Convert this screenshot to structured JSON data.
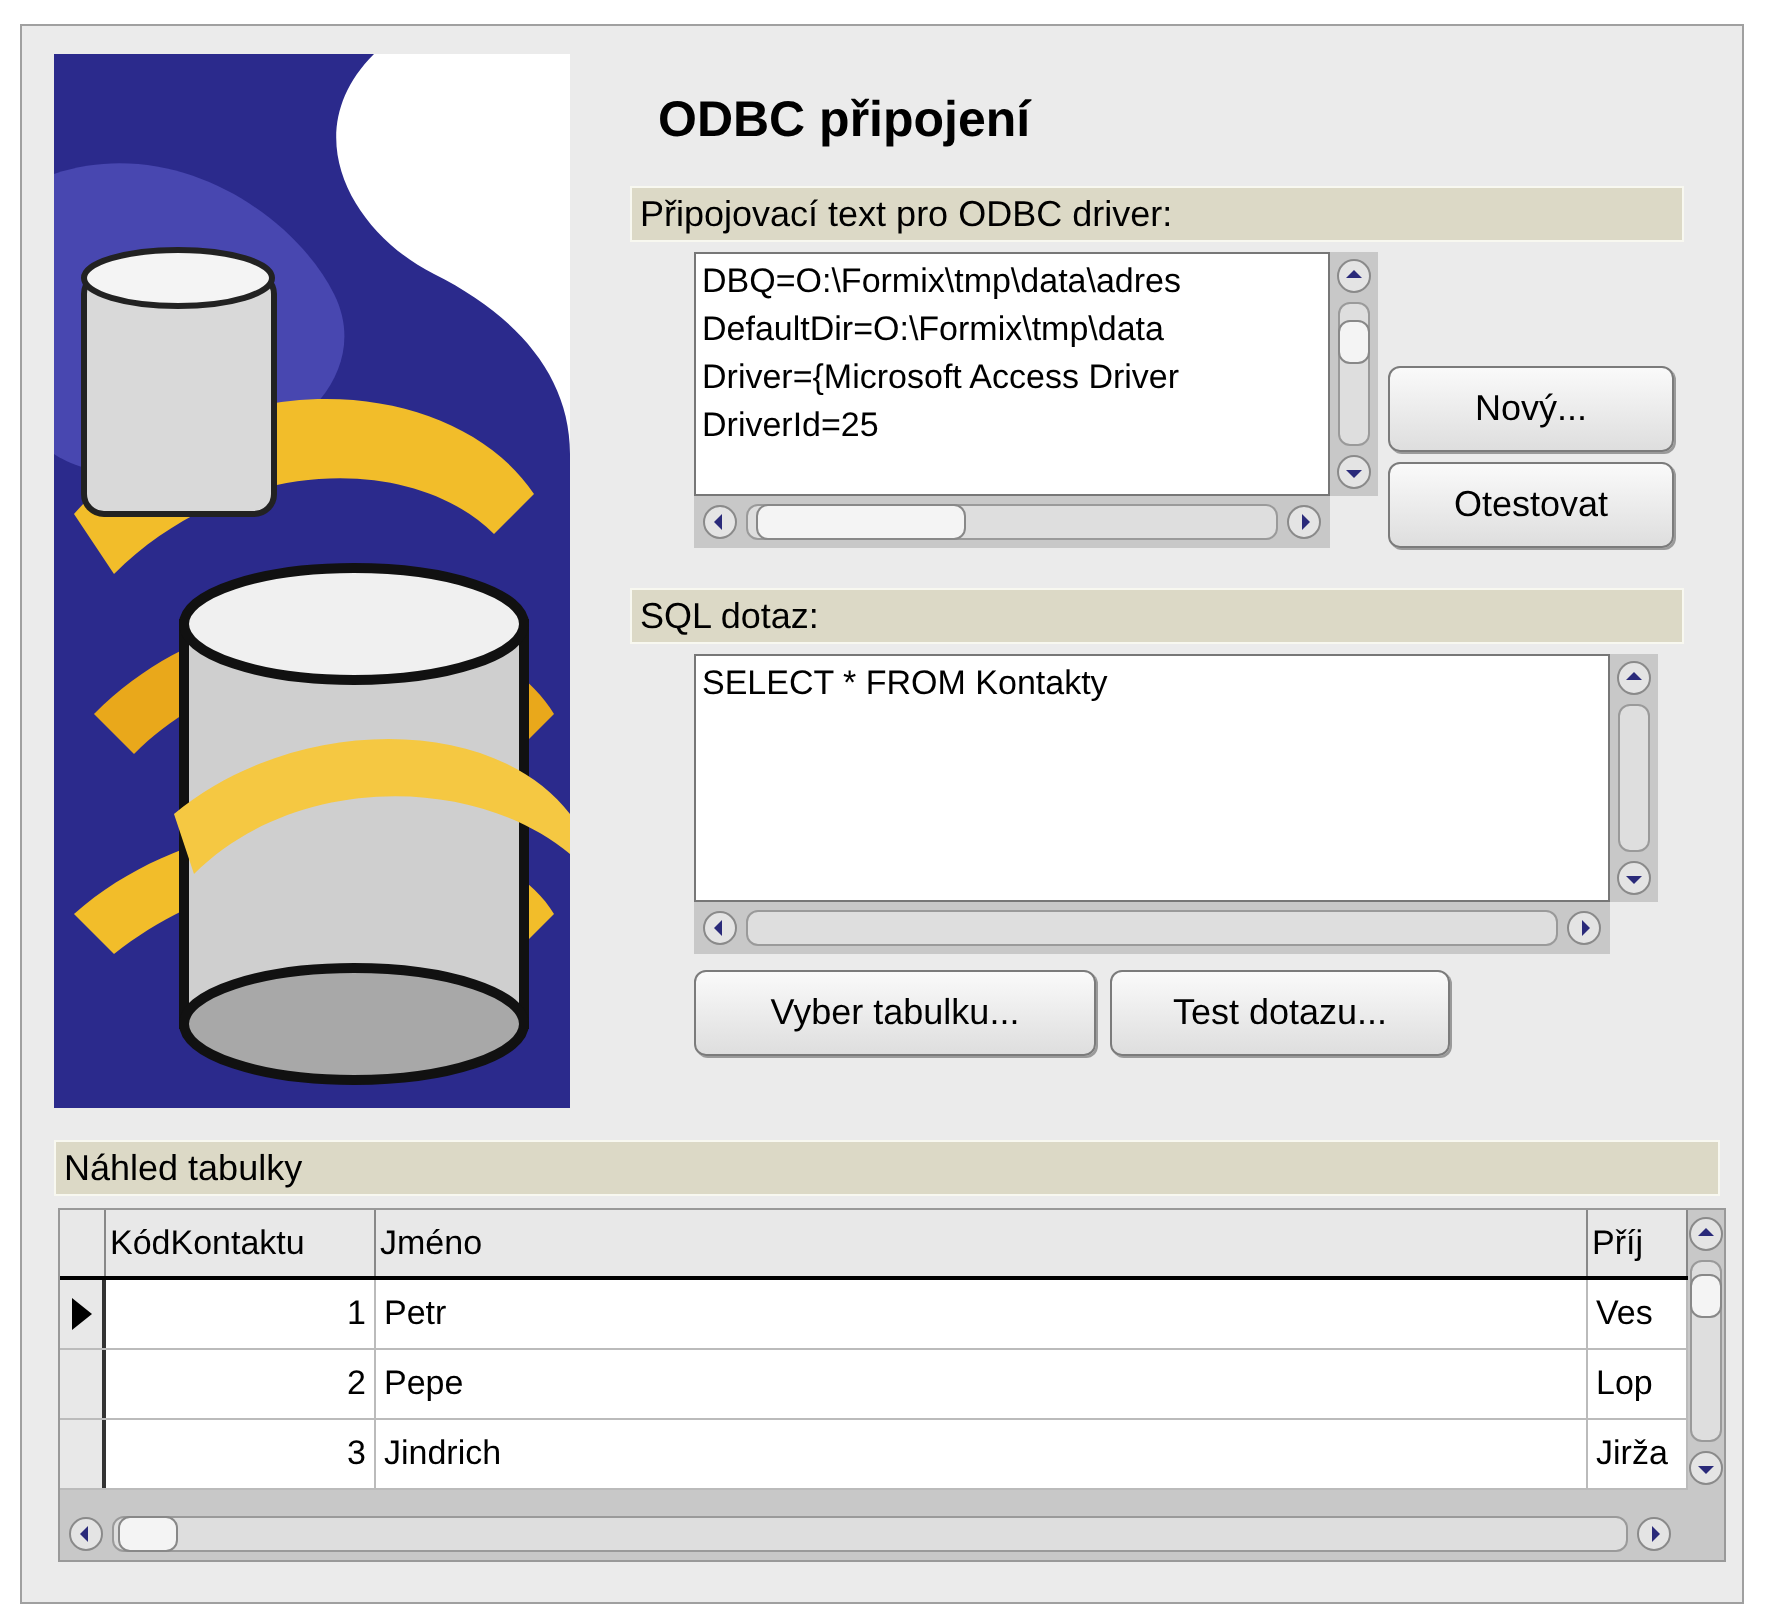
{
  "title": "ODBC připojení",
  "connection": {
    "label": "Připojovací text pro ODBC driver:",
    "lines": [
      "DBQ=O:\\Formix\\tmp\\data\\adres",
      "DefaultDir=O:\\Formix\\tmp\\data",
      "Driver={Microsoft Access Driver",
      "DriverId=25"
    ]
  },
  "connection_buttons": [
    "Nový...",
    "Otestovat"
  ],
  "sql": {
    "label": "SQL dotaz:",
    "lines": [
      "SELECT * FROM Kontakty"
    ]
  },
  "sql_buttons": [
    "Vyber tabulku...",
    "Test dotazu..."
  ],
  "preview": {
    "label": "Náhled tabulky",
    "columns": [
      "KódKontaktu",
      "Jméno",
      "Příj"
    ],
    "rows": [
      {
        "selected": true,
        "cells": [
          "1",
          "Petr",
          "Ves"
        ]
      },
      {
        "selected": false,
        "cells": [
          "2",
          "Pepe",
          "Lop"
        ]
      },
      {
        "selected": false,
        "cells": [
          "3",
          "Jindrich",
          "Jirža"
        ]
      }
    ]
  }
}
